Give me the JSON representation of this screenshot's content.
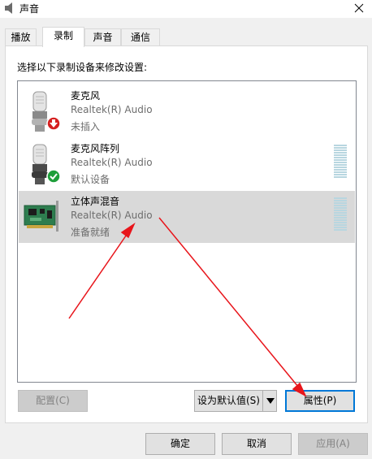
{
  "window": {
    "title": "声音",
    "icon": "speaker-icon",
    "close_icon": "close-icon"
  },
  "tabs": [
    {
      "label": "播放",
      "active": false
    },
    {
      "label": "录制",
      "active": true
    },
    {
      "label": "声音",
      "active": false
    },
    {
      "label": "通信",
      "active": false
    }
  ],
  "instruction": "选择以下录制设备来修改设置:",
  "devices": [
    {
      "name": "麦克风",
      "driver": "Realtek(R) Audio",
      "status": "未插入",
      "icon": "microphone-icon",
      "badge": "unplugged-red-arrow-badge",
      "selected": false,
      "meter": false
    },
    {
      "name": "麦克风阵列",
      "driver": "Realtek(R) Audio",
      "status": "默认设备",
      "icon": "microphone-icon",
      "badge": "default-green-check-badge",
      "selected": false,
      "meter": true
    },
    {
      "name": "立体声混音",
      "driver": "Realtek(R) Audio",
      "status": "准备就绪",
      "icon": "sound-card-icon",
      "badge": "",
      "selected": true,
      "meter": true
    }
  ],
  "buttons": {
    "configure": "配置(C)",
    "set_default": "设为默认值(S)",
    "properties": "属性(P)",
    "ok": "确定",
    "cancel": "取消",
    "apply": "应用(A)"
  },
  "colors": {
    "annotation_arrow": "#e8151b",
    "selection": "#d9d9d9",
    "focus": "#0078d7",
    "check": "#1e9e3a",
    "unplugged": "#d51f1f"
  }
}
